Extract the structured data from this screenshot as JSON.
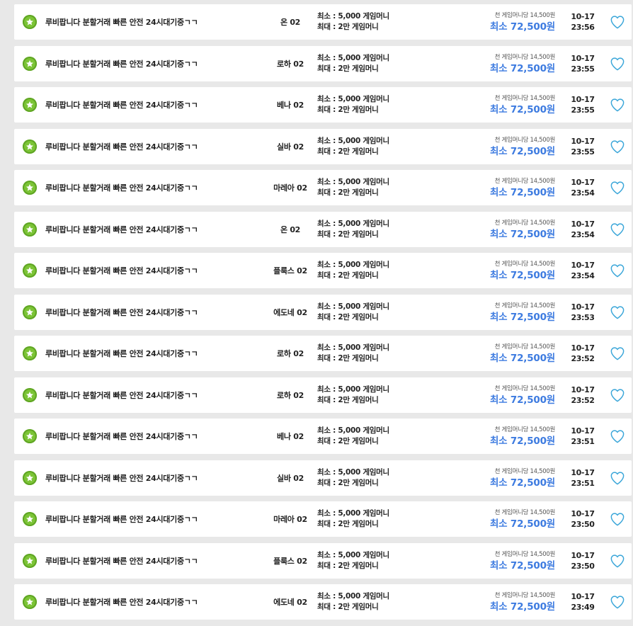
{
  "listing_title": "루비팝니다 분할거래 빠른 안전 24시대기중ㄱㄱ",
  "min_text": "최소 : 5,000 게임머니",
  "max_text": "최대 : 2만 게임머니",
  "unit_price": "천 게임머니당 14,500원",
  "total_price": "최소 72,500원",
  "colors": {
    "accent_price": "#3d7be0",
    "badge": "#7cc436",
    "heart": "#3aa6d9"
  },
  "icons": {
    "badge": "star-badge-icon",
    "favorite": "heart-icon"
  },
  "rows": [
    {
      "server": "온 02",
      "date": "10-17",
      "time": "23:56"
    },
    {
      "server": "로하 02",
      "date": "10-17",
      "time": "23:55"
    },
    {
      "server": "베나 02",
      "date": "10-17",
      "time": "23:55"
    },
    {
      "server": "실바 02",
      "date": "10-17",
      "time": "23:55"
    },
    {
      "server": "마레아 02",
      "date": "10-17",
      "time": "23:54"
    },
    {
      "server": "온 02",
      "date": "10-17",
      "time": "23:54"
    },
    {
      "server": "플룩스 02",
      "date": "10-17",
      "time": "23:54"
    },
    {
      "server": "에도네 02",
      "date": "10-17",
      "time": "23:53"
    },
    {
      "server": "로하 02",
      "date": "10-17",
      "time": "23:52"
    },
    {
      "server": "로하 02",
      "date": "10-17",
      "time": "23:52"
    },
    {
      "server": "베나 02",
      "date": "10-17",
      "time": "23:51"
    },
    {
      "server": "실바 02",
      "date": "10-17",
      "time": "23:51"
    },
    {
      "server": "마레아 02",
      "date": "10-17",
      "time": "23:50"
    },
    {
      "server": "플룩스 02",
      "date": "10-17",
      "time": "23:50"
    },
    {
      "server": "에도네 02",
      "date": "10-17",
      "time": "23:49"
    }
  ]
}
